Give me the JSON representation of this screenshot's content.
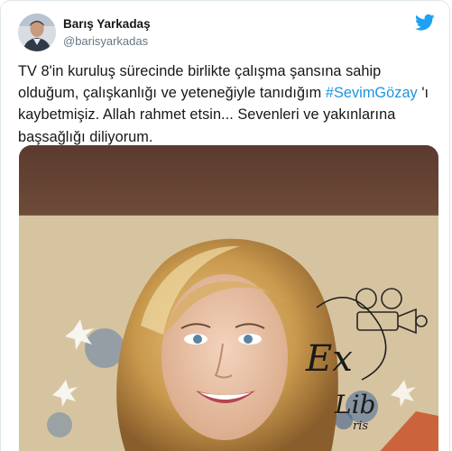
{
  "author": {
    "display_name": "Barış Yarkadaş",
    "handle": "@barisyarkadas",
    "avatar_icon": "profile-photo"
  },
  "brand": {
    "icon": "twitter-bird-icon",
    "color": "#1da1f2"
  },
  "tweet": {
    "text_part1": "TV 8'in kuruluş sürecinde birlikte çalışma şansına sahip olduğum, çalışkanlığı ve yeteneğiyle tanıdığım ",
    "hashtag": "#SevimGözay",
    "text_part2": " 'ı kaybetmişiz. Allah rahmet etsin... Sevenleri ve yakınlarına başsağlığı diliyorum.",
    "hashtag_color": "#1b95e0"
  },
  "media": {
    "description_icon": "portrait-illustration",
    "overlay_text_1": "Ex",
    "overlay_text_2": "Lib",
    "overlay_text_3": "ris"
  }
}
